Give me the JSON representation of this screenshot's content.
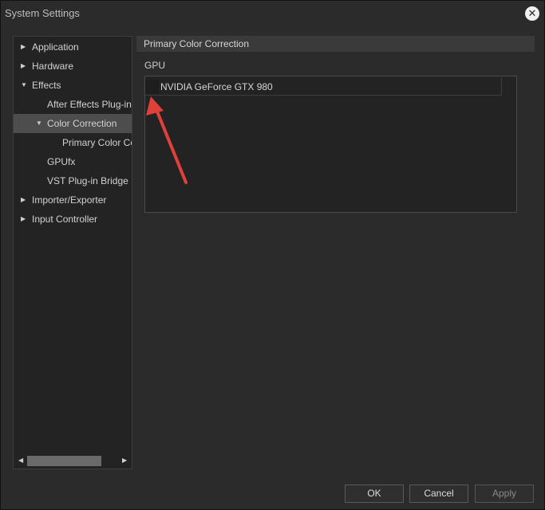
{
  "window": {
    "title": "System Settings"
  },
  "sidebar": {
    "items": [
      {
        "label": "Application",
        "arrow": "▶"
      },
      {
        "label": "Hardware",
        "arrow": "▶"
      },
      {
        "label": "Effects",
        "arrow": "▼"
      },
      {
        "label": "After Effects Plug-in Bridge",
        "arrow": ""
      },
      {
        "label": "Color Correction",
        "arrow": "▼"
      },
      {
        "label": "Primary Color Correction",
        "arrow": ""
      },
      {
        "label": "GPUfx",
        "arrow": ""
      },
      {
        "label": "VST Plug-in Bridge",
        "arrow": ""
      },
      {
        "label": "Importer/Exporter",
        "arrow": "▶"
      },
      {
        "label": "Input Controller",
        "arrow": "▶"
      }
    ],
    "selected": "Color Correction"
  },
  "main": {
    "section_title": "Primary Color Correction",
    "gpu_label": "GPU",
    "gpus": [
      {
        "name": "NVIDIA GeForce GTX 980",
        "checked": false
      }
    ]
  },
  "buttons": {
    "ok": "OK",
    "cancel": "Cancel",
    "apply": "Apply"
  },
  "icons": {
    "close": "close-icon",
    "scroll_left": "arrow-left-icon",
    "scroll_right": "arrow-right-icon"
  },
  "colors": {
    "annotation_arrow": "#e0403a",
    "selected_row": "#4d4d4d"
  }
}
